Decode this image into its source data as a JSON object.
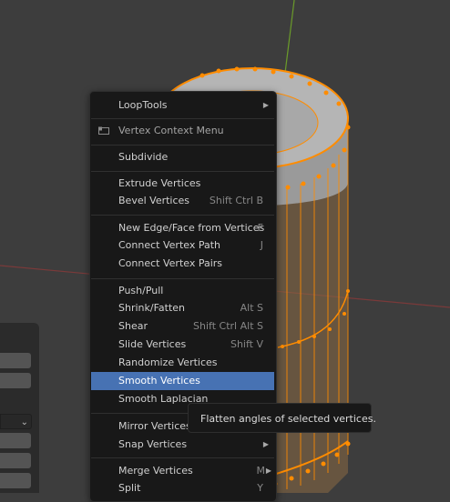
{
  "menu": {
    "items": [
      {
        "label": "LoopTools",
        "shortcut": "",
        "submenu": true
      },
      {
        "label": "Vertex Context Menu",
        "shortcut": "",
        "submenu": false,
        "title": true
      },
      {
        "label": "Subdivide",
        "shortcut": ""
      },
      {
        "label": "Extrude Vertices",
        "shortcut": ""
      },
      {
        "label": "Bevel Vertices",
        "shortcut": "Shift Ctrl B"
      },
      {
        "label": "New Edge/Face from Vertices",
        "shortcut": "F"
      },
      {
        "label": "Connect Vertex Path",
        "shortcut": "J"
      },
      {
        "label": "Connect Vertex Pairs",
        "shortcut": ""
      },
      {
        "label": "Push/Pull",
        "shortcut": ""
      },
      {
        "label": "Shrink/Fatten",
        "shortcut": "Alt S"
      },
      {
        "label": "Shear",
        "shortcut": "Shift Ctrl Alt S"
      },
      {
        "label": "Slide Vertices",
        "shortcut": "Shift V"
      },
      {
        "label": "Randomize Vertices",
        "shortcut": ""
      },
      {
        "label": "Smooth Vertices",
        "shortcut": "",
        "active": true
      },
      {
        "label": "Smooth Laplacian",
        "shortcut": ""
      },
      {
        "label": "Mirror Vertices",
        "shortcut": ""
      },
      {
        "label": "Snap Vertices",
        "shortcut": "",
        "submenu": true
      },
      {
        "label": "Merge Vertices",
        "shortcut": "M",
        "submenu": true
      },
      {
        "label": "Split",
        "shortcut": "Y"
      }
    ]
  },
  "tooltip": {
    "text": "Flatten angles of selected vertices."
  },
  "colors": {
    "accent": "#4772b3",
    "selection": "#ff8c00",
    "menu_bg": "#181818",
    "viewport_bg": "#3d3d3d"
  },
  "icons": {
    "submenu": "triangle-right-icon",
    "title": "vertex-icon"
  }
}
